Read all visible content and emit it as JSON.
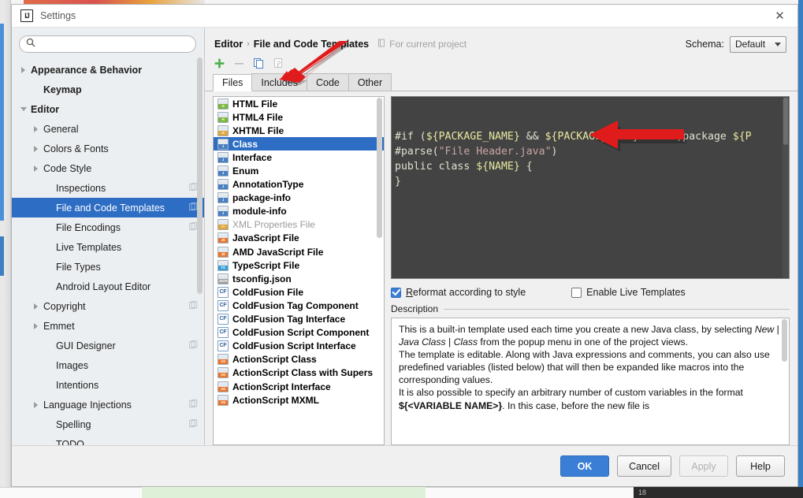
{
  "window": {
    "title": "Settings",
    "logo_text": "IJ",
    "close_icon": "✕"
  },
  "search": {
    "value": "",
    "placeholder": ""
  },
  "sidebar": {
    "items": [
      {
        "label": "Appearance & Behavior",
        "twisty": "collapsed",
        "bold": true,
        "indent": 8,
        "badge": false,
        "selected": false
      },
      {
        "label": "Keymap",
        "twisty": "none",
        "bold": true,
        "indent": 24,
        "badge": false,
        "selected": false
      },
      {
        "label": "Editor",
        "twisty": "expanded",
        "bold": true,
        "indent": 8,
        "badge": false,
        "selected": false
      },
      {
        "label": "General",
        "twisty": "collapsed",
        "bold": false,
        "indent": 24,
        "badge": false,
        "selected": false
      },
      {
        "label": "Colors & Fonts",
        "twisty": "collapsed",
        "bold": false,
        "indent": 24,
        "badge": false,
        "selected": false
      },
      {
        "label": "Code Style",
        "twisty": "collapsed",
        "bold": false,
        "indent": 24,
        "badge": false,
        "selected": false
      },
      {
        "label": "Inspections",
        "twisty": "none",
        "bold": false,
        "indent": 40,
        "badge": true,
        "selected": false
      },
      {
        "label": "File and Code Templates",
        "twisty": "none",
        "bold": false,
        "indent": 40,
        "badge": true,
        "selected": true
      },
      {
        "label": "File Encodings",
        "twisty": "none",
        "bold": false,
        "indent": 40,
        "badge": true,
        "selected": false
      },
      {
        "label": "Live Templates",
        "twisty": "none",
        "bold": false,
        "indent": 40,
        "badge": false,
        "selected": false
      },
      {
        "label": "File Types",
        "twisty": "none",
        "bold": false,
        "indent": 40,
        "badge": false,
        "selected": false
      },
      {
        "label": "Android Layout Editor",
        "twisty": "none",
        "bold": false,
        "indent": 40,
        "badge": false,
        "selected": false
      },
      {
        "label": "Copyright",
        "twisty": "collapsed",
        "bold": false,
        "indent": 24,
        "badge": true,
        "selected": false
      },
      {
        "label": "Emmet",
        "twisty": "collapsed",
        "bold": false,
        "indent": 24,
        "badge": false,
        "selected": false
      },
      {
        "label": "GUI Designer",
        "twisty": "none",
        "bold": false,
        "indent": 40,
        "badge": true,
        "selected": false
      },
      {
        "label": "Images",
        "twisty": "none",
        "bold": false,
        "indent": 40,
        "badge": false,
        "selected": false
      },
      {
        "label": "Intentions",
        "twisty": "none",
        "bold": false,
        "indent": 40,
        "badge": false,
        "selected": false
      },
      {
        "label": "Language Injections",
        "twisty": "collapsed",
        "bold": false,
        "indent": 24,
        "badge": true,
        "selected": false
      },
      {
        "label": "Spelling",
        "twisty": "none",
        "bold": false,
        "indent": 40,
        "badge": true,
        "selected": false
      },
      {
        "label": "TODO",
        "twisty": "none",
        "bold": false,
        "indent": 40,
        "badge": false,
        "selected": false
      }
    ]
  },
  "header": {
    "crumb_parent": "Editor",
    "crumb_sep": "›",
    "crumb_current": "File and Code Templates",
    "for_current_project": "For current project",
    "schema_label": "Schema:",
    "schema_value": "Default"
  },
  "toolbar": {
    "add_icon": "plus-icon",
    "remove_icon": "minus-icon",
    "copy_icon": "copy-icon",
    "reset_icon": "reset-icon"
  },
  "tabs": [
    {
      "label": "Files",
      "active": true
    },
    {
      "label": "Includes",
      "active": false
    },
    {
      "label": "Code",
      "active": false
    },
    {
      "label": "Other",
      "active": false
    }
  ],
  "templates": [
    {
      "label": "HTML File",
      "tag": "H",
      "color": "#7bb63f",
      "style": "file",
      "selected": false,
      "dim": false
    },
    {
      "label": "HTML4 File",
      "tag": "H",
      "color": "#7bb63f",
      "style": "file",
      "selected": false,
      "dim": false
    },
    {
      "label": "XHTML File",
      "tag": "H",
      "color": "#e0a53b",
      "style": "file",
      "selected": false,
      "dim": false
    },
    {
      "label": "Class",
      "tag": "J",
      "color": "#4a7fc1",
      "style": "file",
      "selected": true,
      "dim": false
    },
    {
      "label": "Interface",
      "tag": "J",
      "color": "#4a7fc1",
      "style": "file",
      "selected": false,
      "dim": false
    },
    {
      "label": "Enum",
      "tag": "J",
      "color": "#4a7fc1",
      "style": "file",
      "selected": false,
      "dim": false
    },
    {
      "label": "AnnotationType",
      "tag": "J",
      "color": "#4a7fc1",
      "style": "file",
      "selected": false,
      "dim": false
    },
    {
      "label": "package-info",
      "tag": "J",
      "color": "#4a7fc1",
      "style": "file",
      "selected": false,
      "dim": false
    },
    {
      "label": "module-info",
      "tag": "J",
      "color": "#4a7fc1",
      "style": "file",
      "selected": false,
      "dim": false
    },
    {
      "label": "XML Properties File",
      "tag": "<>",
      "color": "#e0a53b",
      "style": "file",
      "selected": false,
      "dim": true
    },
    {
      "label": "JavaScript File",
      "tag": "JS",
      "color": "#e8762c",
      "style": "file",
      "selected": false,
      "dim": false
    },
    {
      "label": "AMD JavaScript File",
      "tag": "JS",
      "color": "#e8762c",
      "style": "file",
      "selected": false,
      "dim": false
    },
    {
      "label": "TypeScript File",
      "tag": "TS",
      "color": "#3a9cd4",
      "style": "file",
      "selected": false,
      "dim": false
    },
    {
      "label": "tsconfig.json",
      "tag": "JSON",
      "color": "#9a9a9a",
      "style": "file",
      "selected": false,
      "dim": false
    },
    {
      "label": "ColdFusion File",
      "tag": "CF",
      "color": "#2a6099",
      "style": "cf",
      "selected": false,
      "dim": false
    },
    {
      "label": "ColdFusion Tag Component",
      "tag": "CF",
      "color": "#2a6099",
      "style": "cf",
      "selected": false,
      "dim": false
    },
    {
      "label": "ColdFusion Tag Interface",
      "tag": "CF",
      "color": "#2a6099",
      "style": "cf",
      "selected": false,
      "dim": false
    },
    {
      "label": "ColdFusion Script Component",
      "tag": "CF",
      "color": "#2a6099",
      "style": "cf",
      "selected": false,
      "dim": false
    },
    {
      "label": "ColdFusion Script Interface",
      "tag": "CF",
      "color": "#2a6099",
      "style": "cf",
      "selected": false,
      "dim": false
    },
    {
      "label": "ActionScript Class",
      "tag": "AS",
      "color": "#e8762c",
      "style": "file",
      "selected": false,
      "dim": false
    },
    {
      "label": "ActionScript Class with Supers",
      "tag": "AS",
      "color": "#e8762c",
      "style": "file",
      "selected": false,
      "dim": false
    },
    {
      "label": "ActionScript Interface",
      "tag": "AS",
      "color": "#e8762c",
      "style": "file",
      "selected": false,
      "dim": false
    },
    {
      "label": "ActionScript MXML",
      "tag": "AS",
      "color": "#e8762c",
      "style": "file",
      "selected": false,
      "dim": false
    }
  ],
  "editor": {
    "lines": [
      [
        {
          "t": "#if ",
          "c": "plain"
        },
        {
          "t": "(",
          "c": "punct"
        },
        {
          "t": "${PACKAGE_NAME}",
          "c": "var"
        },
        {
          "t": " && ",
          "c": "plain"
        },
        {
          "t": "${PACKAGE_NAME}",
          "c": "var"
        },
        {
          "t": " != ",
          "c": "plain"
        },
        {
          "t": "\"\"",
          "c": "plain"
        },
        {
          "t": ")package ",
          "c": "plain"
        },
        {
          "t": "${P",
          "c": "var"
        }
      ],
      [
        {
          "t": "#parse",
          "c": "plain"
        },
        {
          "t": "(",
          "c": "punct"
        },
        {
          "t": "\"File Header.java\"",
          "c": "str"
        },
        {
          "t": ")",
          "c": "punct"
        }
      ],
      [
        {
          "t": "public class ",
          "c": "plain"
        },
        {
          "t": "${NAME}",
          "c": "var"
        },
        {
          "t": " {",
          "c": "plain"
        }
      ],
      [
        {
          "t": "}",
          "c": "plain"
        }
      ]
    ]
  },
  "options": {
    "reformat_label": "Reformat according to style",
    "reformat_checked": true,
    "live_templates_label": "Enable Live Templates",
    "live_templates_checked": false
  },
  "description": {
    "legend": "Description",
    "paragraphs": [
      "This is a built-in template used each time you create a new Java class, by selecting New | Java Class | Class from the popup menu in one of the project views.",
      "The template is editable. Along with Java expressions and comments, you can also use predefined variables (listed below) that will then be expanded like macros into the corresponding values.",
      "It is also possible to specify an arbitrary number of custom variables in the format ${<VARIABLE NAME>}. In this case, before the new file is"
    ]
  },
  "footer": {
    "ok": "OK",
    "cancel": "Cancel",
    "apply": "Apply",
    "help": "Help"
  },
  "background": {
    "status_number": "18"
  },
  "colors": {
    "accent_blue": "#2d6dc4",
    "primary_button": "#3a7fd5",
    "editor_bg": "#434343",
    "sidebar_bg": "#eceff1",
    "dialog_bg": "#f0f0f0",
    "annotation_red": "#e01b1b"
  }
}
